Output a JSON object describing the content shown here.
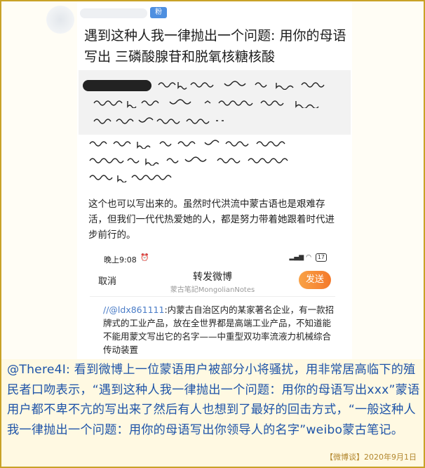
{
  "post": {
    "badge": "粉",
    "text": "遇到这种人我一律抛出一个问题: 用你的母语写出 三磷酸腺苷和脱氧核糖核酸",
    "body": "这个也可以写出来的。虽然时代洪流中蒙古语也是艰难存活，但我们一代代热爱她的人，都是努力带着她跟着时代进步前行的。"
  },
  "repost_screen": {
    "status_time": "晚上9:08",
    "battery": "17",
    "cancel_label": "取消",
    "title": "转发微博",
    "subtitle": "蒙古笔記MongolianNotes",
    "send_label": "发送",
    "mention": "//@ldx861111",
    "text": ":内蒙古自治区内的某家著名企业，有一款招牌式的工业产品，放在全世界都是高端工业产品，不知道能不能用蒙文写出它的名字——中重型双功率流液力机械综合传动装置"
  },
  "caption": {
    "text": "@There4I: 看到微博上一位蒙语用户被部分小将骚扰，用非常居高临下的殖民者口吻表示，“遇到这种人我一律抛出一个问题：用你的母语写出xxx”蒙语用户都不卑不亢的写出来了然后有人也想到了最好的回击方式，“一般这种人我一律抛出一个问题：用你的母语写出你领导人的名字”weibo蒙古笔记。",
    "tag": "【微博谈】2020年9月1日"
  },
  "colors": {
    "frame": "#c9a227",
    "caption_text": "#1f54a8",
    "send_button": "#f4792b",
    "mention": "#4a7cc7"
  }
}
